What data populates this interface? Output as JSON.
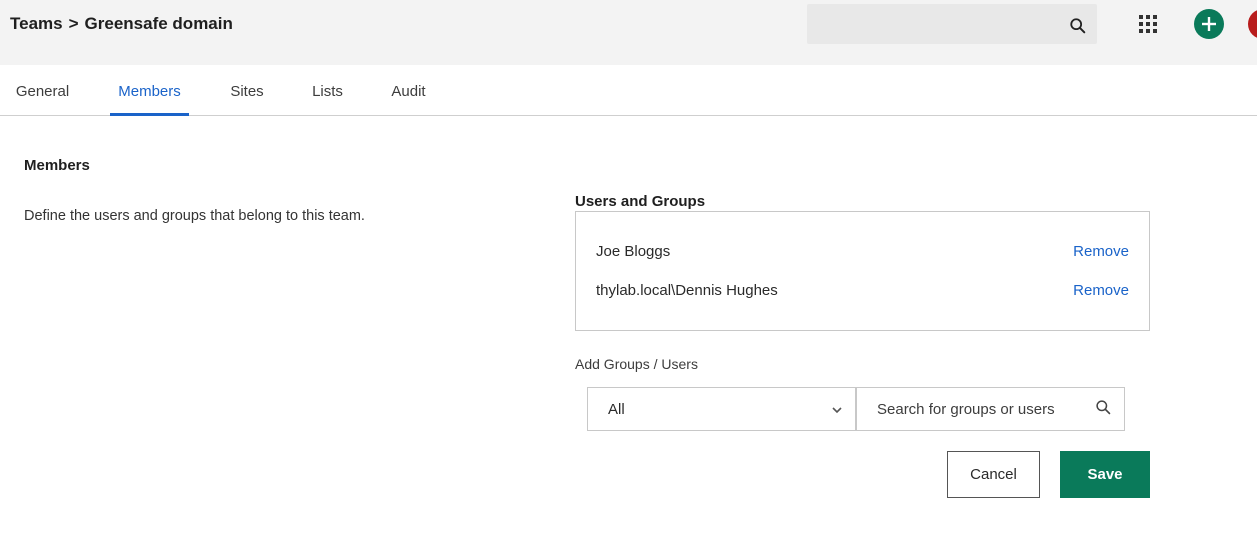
{
  "header": {
    "breadcrumb": [
      "Teams",
      "Greensafe domain"
    ],
    "breadcrumb_separator": ">",
    "search_placeholder": "",
    "icons": [
      "search-icon",
      "apps-grid-icon",
      "add-icon",
      "avatar"
    ],
    "accent_color": "#0a7a5a",
    "avatar_color": "#b81c1c"
  },
  "tabs": [
    {
      "label": "General",
      "active": false
    },
    {
      "label": "Members",
      "active": true
    },
    {
      "label": "Sites",
      "active": false
    },
    {
      "label": "Lists",
      "active": false
    },
    {
      "label": "Audit",
      "active": false
    }
  ],
  "members_section": {
    "title": "Members",
    "description": "Define the users and groups that belong to this team."
  },
  "users_and_groups": {
    "label": "Users and Groups",
    "items": [
      {
        "name": "Joe Bloggs",
        "action": "Remove"
      },
      {
        "name": "thylab.local\\Dennis Hughes",
        "action": "Remove"
      }
    ]
  },
  "add_groups_users": {
    "label": "Add Groups / Users",
    "filter_selected": "All",
    "search_placeholder": "Search for groups or users"
  },
  "actions": {
    "cancel_label": "Cancel",
    "save_label": "Save"
  },
  "colors": {
    "link": "#1a63c9",
    "save_button": "#0a7a5a"
  }
}
